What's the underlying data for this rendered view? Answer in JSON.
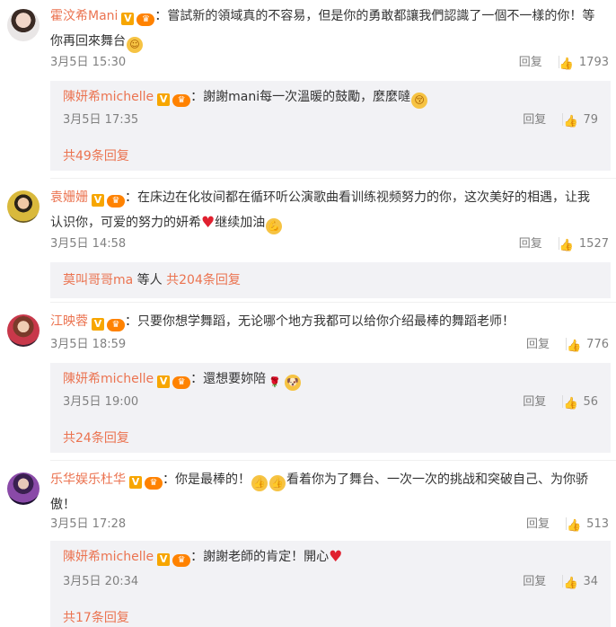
{
  "comments": [
    {
      "user": "霍汶希Mani",
      "text_line1": "：嘗試新的領域真的不容易，但是你的勇敢都讓我們認識了一個不一樣的你！等",
      "text_line2": "你再回來舞台",
      "time": "3月5日 15:30",
      "reply_label": "回复",
      "likes": "1793",
      "reply": {
        "user": "陳妍希michelle",
        "text": "：謝謝mani每一次溫暖的鼓勵，麼麼噠",
        "time": "3月5日 17:35",
        "reply_label": "回复",
        "likes": "79"
      },
      "more_text": "共49条回复"
    },
    {
      "user": "袁姗姗",
      "text_line1": "：在床边在化妆间都在循环听公演歌曲看训练视频努力的你，这次美好的相遇，让我",
      "text_line2": "认识你，可爱的努力的妍希",
      "text_line2b": "继续加油",
      "time": "3月5日 14:58",
      "reply_label": "回复",
      "likes": "1527",
      "more_user": "莫叫哥哥ma",
      "more_mid": " 等人 ",
      "more_text": "共204条回复"
    },
    {
      "user": "江映蓉",
      "text_line1": "：只要你想学舞蹈，无论哪个地方我都可以给你介绍最棒的舞蹈老师！",
      "time": "3月5日 18:59",
      "reply_label": "回复",
      "likes": "776",
      "reply": {
        "user": "陳妍希michelle",
        "text": "：還想要妳陪",
        "time": "3月5日 19:00",
        "reply_label": "回复",
        "likes": "56"
      },
      "more_text": "共24条回复"
    },
    {
      "user": "乐华娱乐杜华",
      "text_line1": "：你是最棒的！",
      "text_line1b": "看着你为了舞台、一次一次的挑战和突破自己、为你骄",
      "text_line2": "傲！",
      "time": "3月5日 17:28",
      "reply_label": "回复",
      "likes": "513",
      "reply": {
        "user": "陳妍希michelle",
        "text": "：謝謝老師的肯定！開心",
        "time": "3月5日 20:34",
        "reply_label": "回复",
        "likes": "34"
      },
      "more_text": "共17条回复"
    }
  ],
  "badge_v": "V",
  "badge_fan": "♛"
}
